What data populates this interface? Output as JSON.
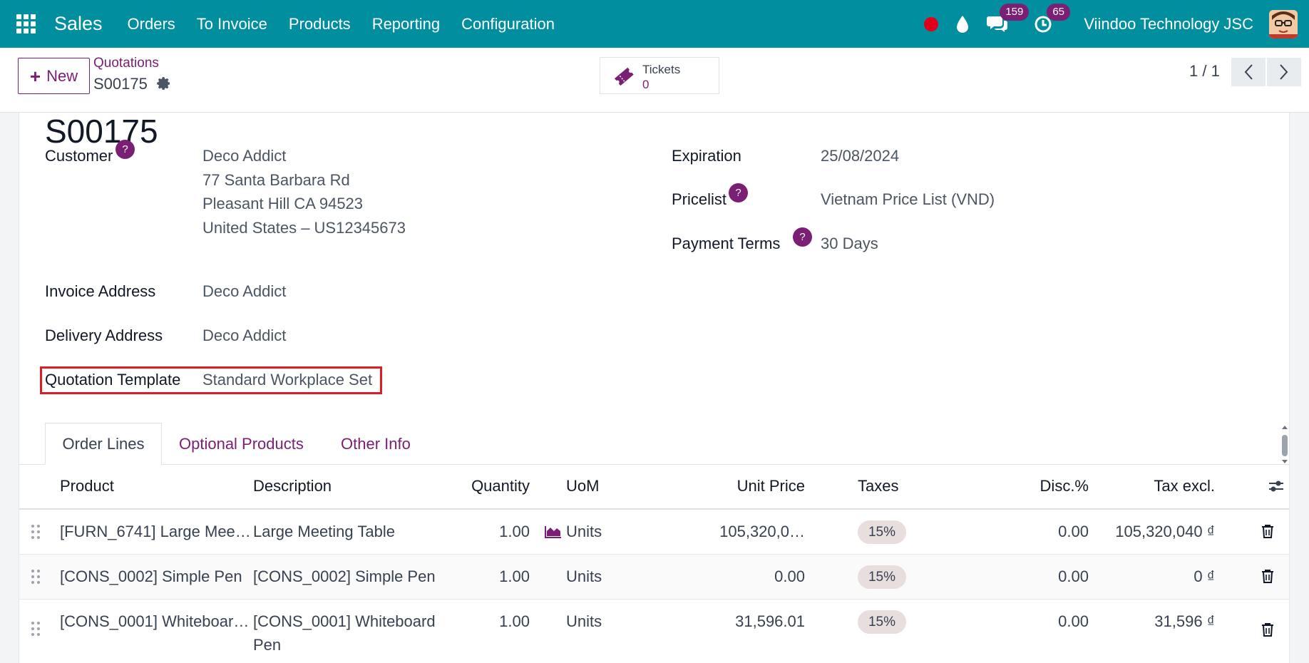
{
  "navbar": {
    "app_name": "Sales",
    "menu": [
      "Orders",
      "To Invoice",
      "Products",
      "Reporting",
      "Configuration"
    ],
    "messages_count": "159",
    "activities_count": "65",
    "company": "Viindoo Technology JSC"
  },
  "control": {
    "new_label": "New",
    "breadcrumb_parent": "Quotations",
    "breadcrumb_current": "S00175",
    "tickets_label": "Tickets",
    "tickets_count": "0",
    "pager": "1 / 1"
  },
  "form": {
    "title": "S00175",
    "customer_label": "Customer",
    "customer_name": "Deco Addict",
    "customer_address": [
      "77 Santa Barbara Rd",
      "Pleasant Hill CA 94523",
      "United States – US12345673"
    ],
    "invoice_address_label": "Invoice Address",
    "invoice_address": "Deco Addict",
    "delivery_address_label": "Delivery Address",
    "delivery_address": "Deco Addict",
    "template_label": "Quotation Template",
    "template_value": "Standard Workplace Set",
    "expiration_label": "Expiration",
    "expiration_value": "25/08/2024",
    "pricelist_label": "Pricelist",
    "pricelist_value": "Vietnam Price List (VND)",
    "payment_terms_label": "Payment Terms",
    "payment_terms_value": "30 Days",
    "help_mark": "?"
  },
  "tabs": [
    "Order Lines",
    "Optional Products",
    "Other Info"
  ],
  "table": {
    "headers": {
      "product": "Product",
      "description": "Description",
      "quantity": "Quantity",
      "uom": "UoM",
      "unit_price": "Unit Price",
      "taxes": "Taxes",
      "discount": "Disc.%",
      "subtotal": "Tax excl."
    },
    "rows": [
      {
        "product": "[FURN_6741] Large Mee…",
        "description": [
          "Large Meeting Table"
        ],
        "quantity": "1.00",
        "uom": "Units",
        "unit_price": "105,320,0…",
        "taxes": "15%",
        "discount": "0.00",
        "subtotal": "105,320,040 ₫"
      },
      {
        "product": "[CONS_0002] Simple Pen",
        "description": [
          "[CONS_0002] Simple Pen"
        ],
        "quantity": "1.00",
        "uom": "Units",
        "unit_price": "0.00",
        "taxes": "15%",
        "discount": "0.00",
        "subtotal": "0 ₫"
      },
      {
        "product": "[CONS_0001] Whiteboar…",
        "description": [
          "[CONS_0001] Whiteboard",
          "Pen"
        ],
        "quantity": "1.00",
        "uom": "Units",
        "unit_price": "31,596.01",
        "taxes": "15%",
        "discount": "0.00",
        "subtotal": "31,596 ₫"
      }
    ]
  },
  "colors": {
    "navbar": "#018e9f",
    "primary": "#7a1f73",
    "highlight_border": "#e01b24",
    "record_dot": "#e1001b"
  }
}
